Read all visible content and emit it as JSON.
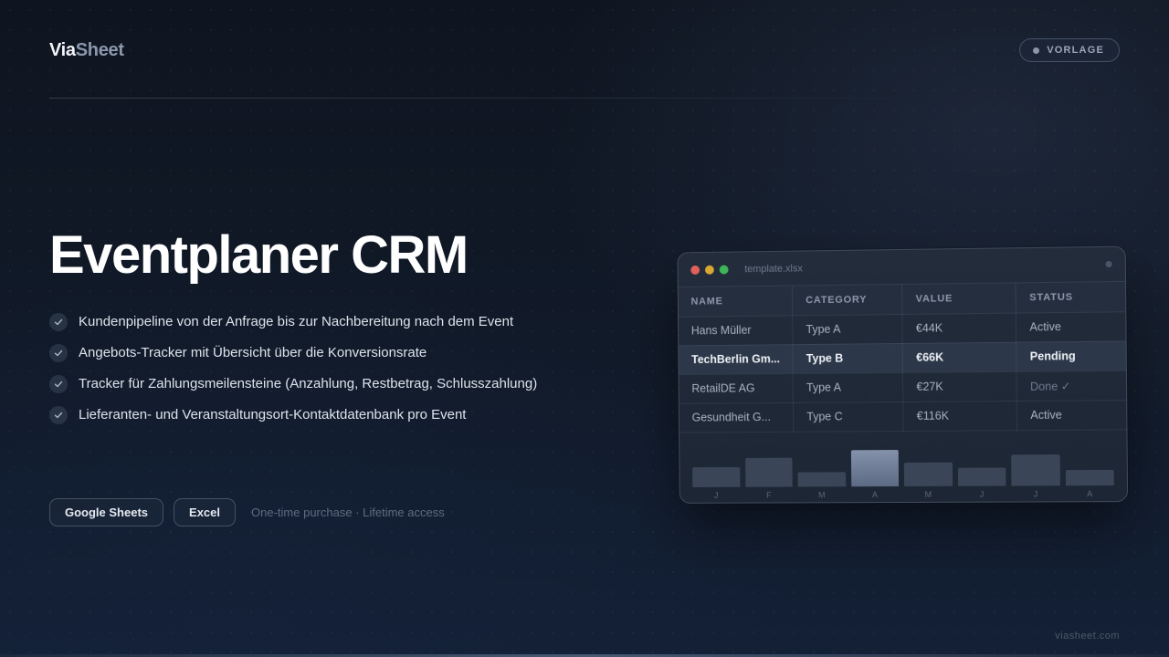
{
  "brand": {
    "part1": "Via",
    "part2": "Sheet"
  },
  "badge": {
    "label": "VORLAGE"
  },
  "hero": {
    "title": "Eventplaner CRM",
    "features": [
      "Kundenpipeline von der Anfrage bis zur Nachbereitung nach dem Event",
      "Angebots-Tracker mit Übersicht über die Konversionsrate",
      "Tracker für Zahlungsmeilensteine (Anzahlung, Restbetrag, Schlusszahlung)",
      "Lieferanten- und Veranstaltungsort-Kontaktdatenbank pro Event"
    ],
    "platforms": [
      "Google Sheets",
      "Excel"
    ],
    "purchase_note": "One-time purchase · Lifetime access"
  },
  "preview": {
    "filename": "template.xlsx",
    "columns": [
      "NAME",
      "CATEGORY",
      "VALUE",
      "STATUS"
    ],
    "rows": [
      [
        "Hans Müller",
        "Type A",
        "€44K",
        "Active"
      ],
      [
        "TechBerlin Gm...",
        "Type B",
        "€66K",
        "Pending"
      ],
      [
        "RetailDE AG",
        "Type A",
        "€27K",
        "Done ✓"
      ],
      [
        "Gesundheit G...",
        "Type C",
        "€116K",
        "Active"
      ]
    ],
    "months": [
      "J",
      "F",
      "M",
      "A",
      "M",
      "J",
      "J",
      "A"
    ]
  },
  "chart_data": {
    "type": "bar",
    "categories": [
      "J",
      "F",
      "M",
      "A",
      "M",
      "J",
      "J",
      "A"
    ],
    "values": [
      40,
      58,
      29,
      72,
      47,
      36,
      62,
      30
    ],
    "highlight_index": 3
  },
  "footer": {
    "url": "viasheet.com"
  },
  "colors": {
    "accent": "#8391ab",
    "traffic_red": "#e0605a",
    "traffic_yellow": "#d9a833",
    "traffic_green": "#3fb55a"
  }
}
